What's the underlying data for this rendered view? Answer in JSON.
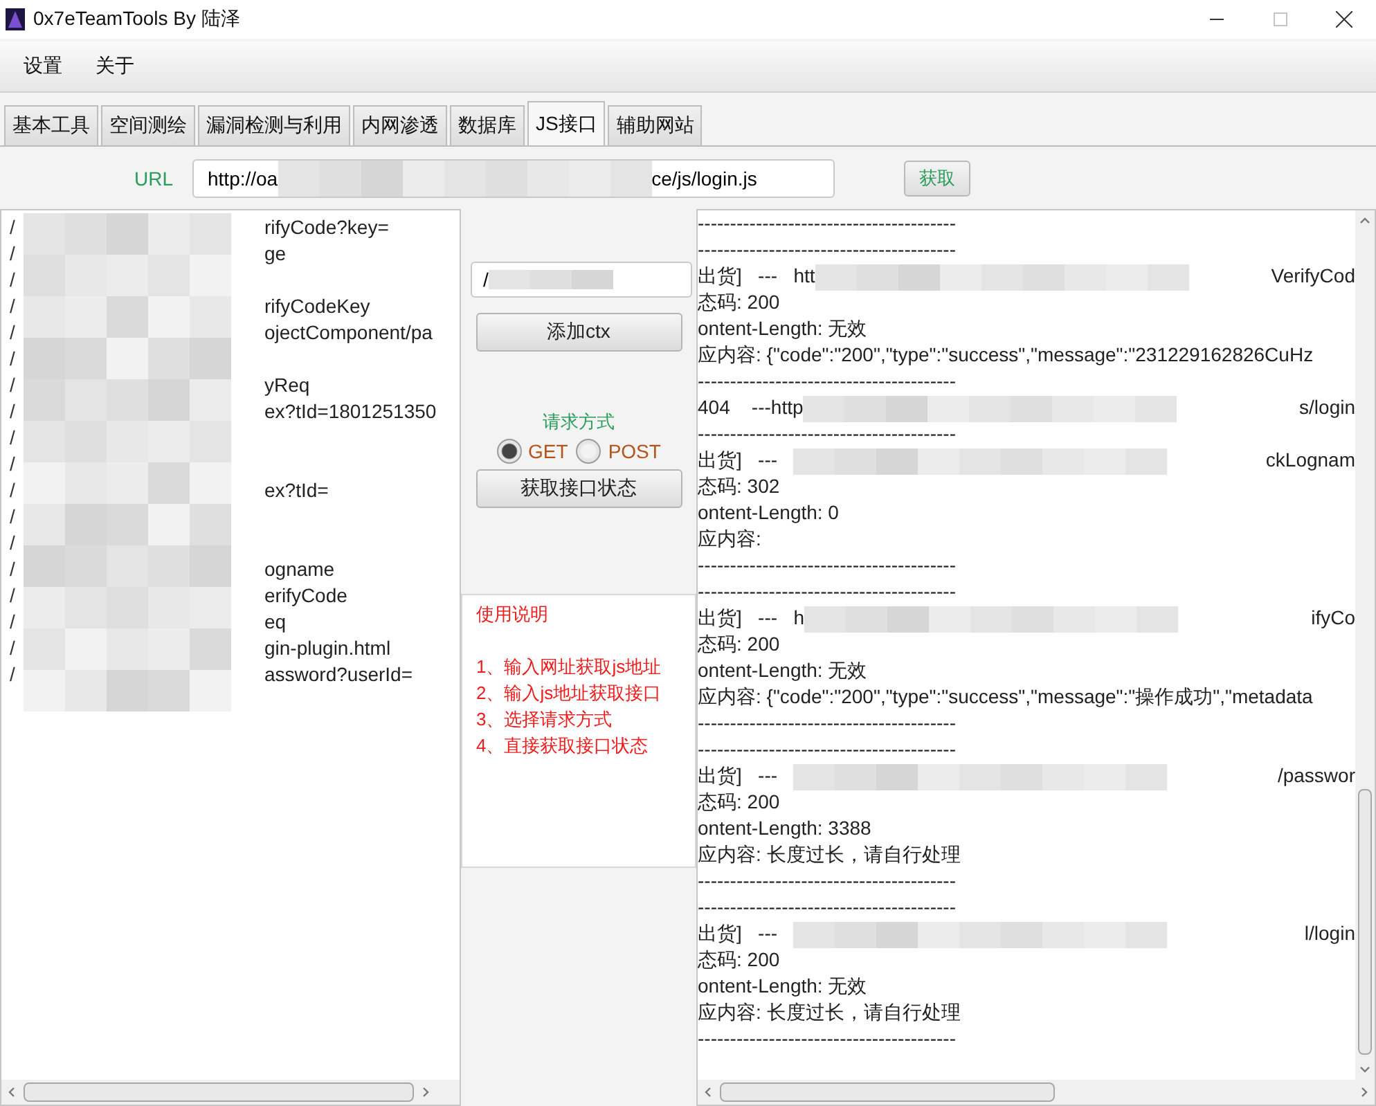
{
  "window": {
    "title": "0x7eTeamTools By 陆泽"
  },
  "menu": [
    "设置",
    "关于"
  ],
  "tabs": [
    {
      "label": "基本工具",
      "selected": false
    },
    {
      "label": "空间测绘",
      "selected": false
    },
    {
      "label": "漏洞检测与利用",
      "selected": false
    },
    {
      "label": "内网渗透",
      "selected": false
    },
    {
      "label": "数据库",
      "selected": false
    },
    {
      "label": "JS接口",
      "selected": true
    },
    {
      "label": "辅助网站",
      "selected": false
    }
  ],
  "url": {
    "label": "URL",
    "start": "http://oa",
    "end": "ce/js/login.js",
    "button": "获取"
  },
  "paths": [
    {
      "start": "/",
      "end": "rifyCode?key="
    },
    {
      "start": "/",
      "end": "ge"
    },
    {
      "start": "/"
    },
    {
      "start": "/",
      "end": "rifyCodeKey"
    },
    {
      "start": "/",
      "end": "ojectComponent/pa"
    },
    {
      "start": "/"
    },
    {
      "start": "/",
      "end": "yReq"
    },
    {
      "start": "/",
      "end": "ex?tId=1801251350"
    },
    {
      "start": "/"
    },
    {
      "start": "/"
    },
    {
      "start": "/",
      "end": "ex?tId="
    },
    {
      "start": "/"
    },
    {
      "start": "/"
    },
    {
      "start": "/",
      "end": "ogname"
    },
    {
      "start": "/",
      "end": "erifyCode"
    },
    {
      "start": "/",
      "end": "eq"
    },
    {
      "start": "/",
      "end": "gin-plugin.html"
    },
    {
      "start": "/",
      "end": "assword?userId="
    }
  ],
  "ctx": {
    "value": "/",
    "button": "添加ctx"
  },
  "method": {
    "label": "请求方式",
    "options": [
      {
        "label": "GET",
        "selected": true
      },
      {
        "label": "POST",
        "selected": false
      }
    ]
  },
  "status_button": "获取接口状态",
  "instructions": {
    "title": "使用说明",
    "steps": [
      "1、输入网址获取js地址",
      "2、输入js地址获取接口",
      "3、选择请求方式",
      "4、直接获取接口状态"
    ]
  },
  "log": [
    {
      "kind": "rule",
      "text": "----------------------------------------"
    },
    {
      "kind": "rule",
      "text": "----------------------------------------"
    },
    {
      "kind": "url",
      "start": "出货]   ---   htt",
      "end": "VerifyCod"
    },
    {
      "kind": "text",
      "text": "态码: 200"
    },
    {
      "kind": "text",
      "text": "ontent-Length: 无效"
    },
    {
      "kind": "text",
      "text": "应内容: {\"code\":\"200\",\"type\":\"success\",\"message\":\"231229162826CuHz"
    },
    {
      "kind": "rule",
      "text": "----------------------------------------"
    },
    {
      "kind": "url",
      "start": "404    ---http",
      "end": "s/login"
    },
    {
      "kind": "rule",
      "text": "----------------------------------------"
    },
    {
      "kind": "url",
      "start": "出货]   ---   ",
      "end": "ckLognam"
    },
    {
      "kind": "text",
      "text": "态码: 302"
    },
    {
      "kind": "text",
      "text": "ontent-Length: 0"
    },
    {
      "kind": "text",
      "text": "应内容:"
    },
    {
      "kind": "rule",
      "text": "----------------------------------------"
    },
    {
      "kind": "rule",
      "text": "----------------------------------------"
    },
    {
      "kind": "url",
      "start": "出货]   ---   h",
      "end": "ifyCo"
    },
    {
      "kind": "text",
      "text": "态码: 200"
    },
    {
      "kind": "text",
      "text": "ontent-Length: 无效"
    },
    {
      "kind": "text",
      "text": "应内容: {\"code\":\"200\",\"type\":\"success\",\"message\":\"操作成功\",\"metadata"
    },
    {
      "kind": "rule",
      "text": "----------------------------------------"
    },
    {
      "kind": "rule",
      "text": "----------------------------------------"
    },
    {
      "kind": "url",
      "start": "出货]   ---   ",
      "end": "/passwor"
    },
    {
      "kind": "text",
      "text": "态码: 200"
    },
    {
      "kind": "text",
      "text": "ontent-Length: 3388"
    },
    {
      "kind": "text",
      "text": "应内容: 长度过长，请自行处理"
    },
    {
      "kind": "rule",
      "text": "----------------------------------------"
    },
    {
      "kind": "rule",
      "text": "----------------------------------------"
    },
    {
      "kind": "url",
      "start": "出货]   ---   ",
      "end": "l/login"
    },
    {
      "kind": "text",
      "text": "态码: 200"
    },
    {
      "kind": "text",
      "text": "ontent-Length: 无效"
    },
    {
      "kind": "text",
      "text": "应内容: 长度过长，请自行处理"
    },
    {
      "kind": "rule",
      "text": "----------------------------------------"
    }
  ]
}
